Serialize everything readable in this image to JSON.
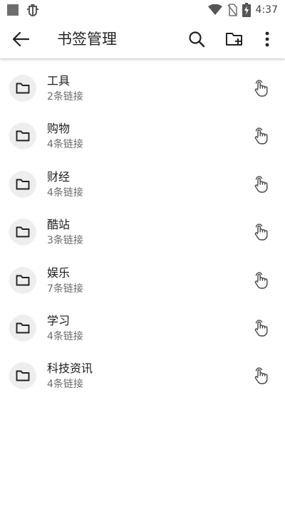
{
  "status_bar": {
    "time": "4:37",
    "icons": [
      "notification-square-icon",
      "bug-icon",
      "wifi-icon",
      "no-sim-icon",
      "battery-charging-icon"
    ]
  },
  "app_bar": {
    "title": "书签管理",
    "back_icon": "arrow-back-icon",
    "actions": [
      "search-icon",
      "create-folder-icon",
      "more-vert-icon"
    ]
  },
  "folders": [
    {
      "name": "工具",
      "count": "2条链接"
    },
    {
      "name": "购物",
      "count": "4条链接"
    },
    {
      "name": "财经",
      "count": "4条链接"
    },
    {
      "name": "酷站",
      "count": "3条链接"
    },
    {
      "name": "娱乐",
      "count": "7条链接"
    },
    {
      "name": "学习",
      "count": "4条链接"
    },
    {
      "name": "科技资讯",
      "count": "4条链接"
    }
  ],
  "item_icons": {
    "leading": "folder-icon",
    "trailing": "touch-drag-icon"
  },
  "colors": {
    "background": "#ffffff",
    "avatar_bg": "#eeeeee",
    "text_primary": "#1c1c1c",
    "text_secondary": "#6b6b6b"
  }
}
